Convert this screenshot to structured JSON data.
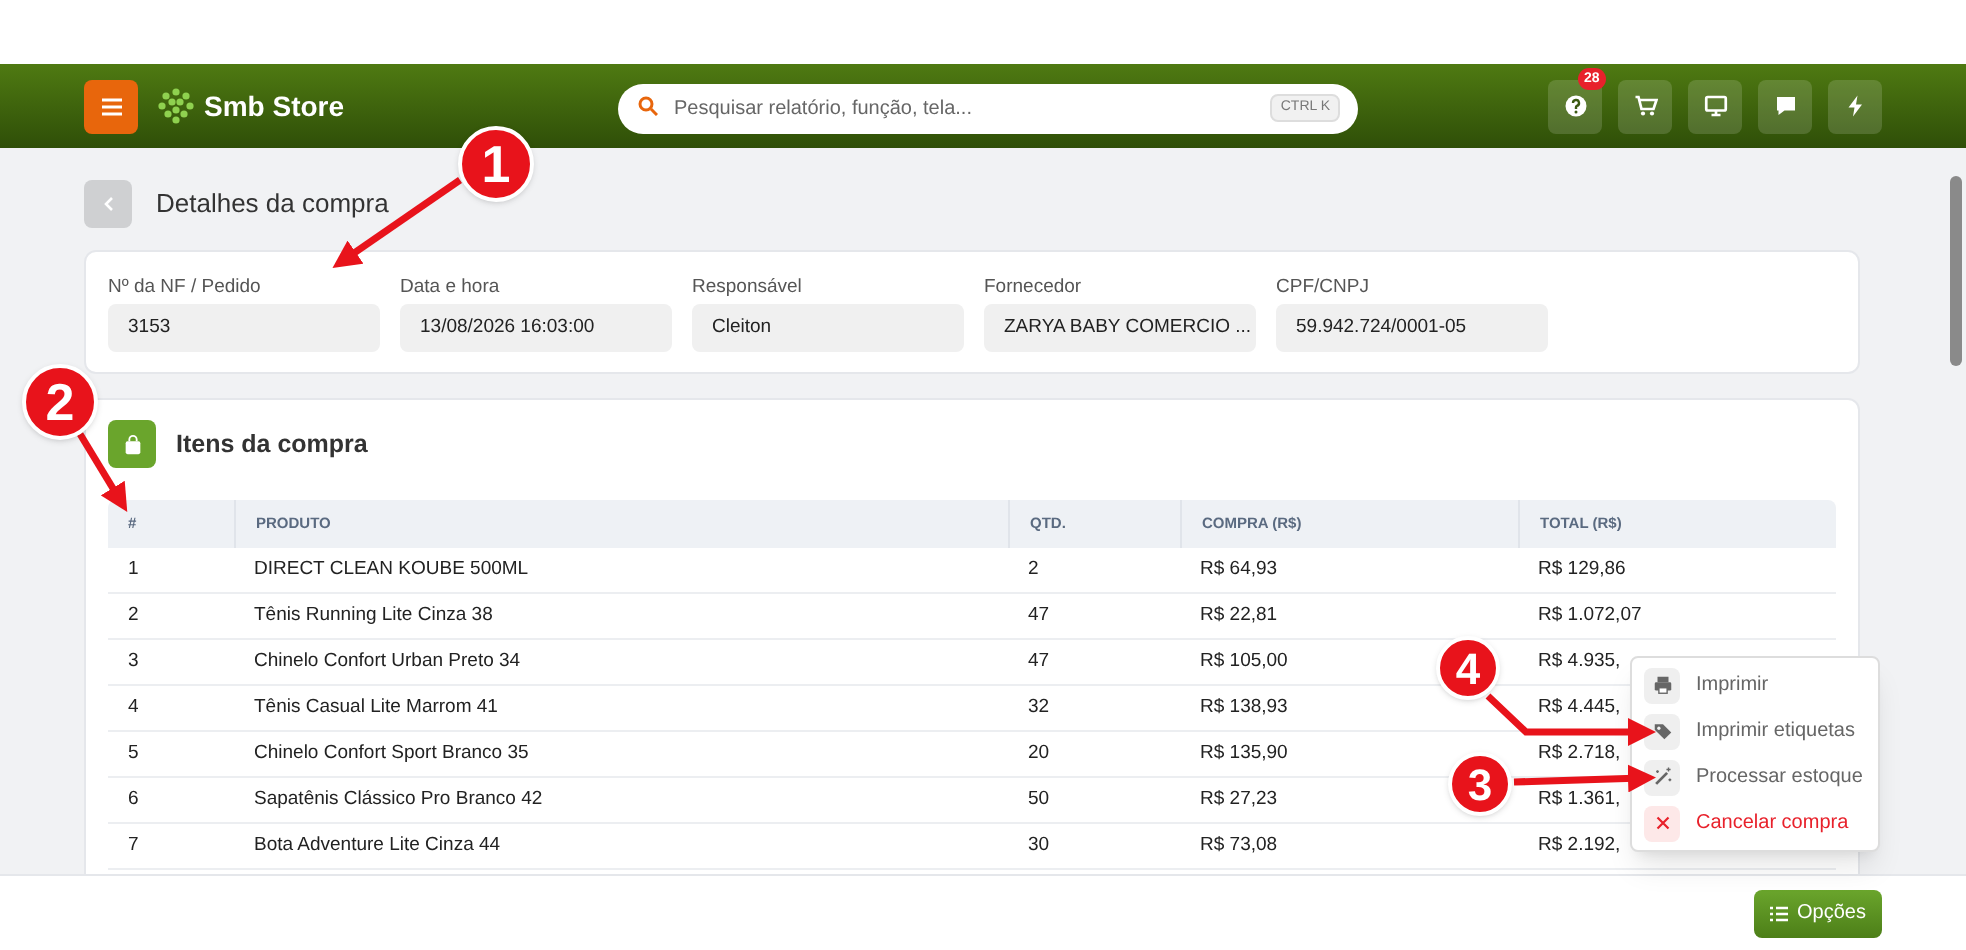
{
  "header": {
    "brand": "Smb Store",
    "search": {
      "placeholder": "Pesquisar relatório, função, tela...",
      "shortcut": "CTRL K"
    },
    "actions": [
      {
        "kind": "help",
        "badge": "28"
      },
      {
        "kind": "cart"
      },
      {
        "kind": "monitor"
      },
      {
        "kind": "chat"
      },
      {
        "kind": "bolt"
      }
    ]
  },
  "page": {
    "title": "Detalhes da compra"
  },
  "fields": [
    {
      "label": "Nº da NF / Pedido",
      "value": "3153"
    },
    {
      "label": "Data e hora",
      "value": "13/08/2026 16:03:00"
    },
    {
      "label": "Responsável",
      "value": "Cleiton"
    },
    {
      "label": "Fornecedor",
      "value": "ZARYA BABY COMERCIO ..."
    },
    {
      "label": "CPF/CNPJ",
      "value": "59.942.724/0001-05"
    }
  ],
  "items": {
    "title": "Itens da compra",
    "columns": [
      "#",
      "PRODUTO",
      "QTD.",
      "COMPRA (R$)",
      "TOTAL (R$)"
    ],
    "rows": [
      [
        "1",
        "DIRECT CLEAN KOUBE 500ML",
        "2",
        "R$ 64,93",
        "R$ 129,86"
      ],
      [
        "2",
        "Tênis Running Lite Cinza 38",
        "47",
        "R$ 22,81",
        "R$ 1.072,07"
      ],
      [
        "3",
        "Chinelo Confort Urban Preto 34",
        "47",
        "R$ 105,00",
        "R$ 4.935,"
      ],
      [
        "4",
        "Tênis Casual Lite Marrom 41",
        "32",
        "R$ 138,93",
        "R$ 4.445,"
      ],
      [
        "5",
        "Chinelo Confort Sport Branco 35",
        "20",
        "R$ 135,90",
        "R$ 2.718,"
      ],
      [
        "6",
        "Sapatênis Clássico Pro Branco 42",
        "50",
        "R$ 27,23",
        "R$ 1.361,"
      ],
      [
        "7",
        "Bota Adventure Lite Cinza 44",
        "30",
        "R$ 73,08",
        "R$ 2.192,"
      ]
    ]
  },
  "menu": [
    {
      "kind": "print",
      "label": "Imprimir"
    },
    {
      "kind": "tags",
      "label": "Imprimir etiquetas"
    },
    {
      "kind": "wand",
      "label": "Processar estoque"
    },
    {
      "kind": "cancel",
      "label": "Cancelar compra"
    }
  ],
  "options_button": "Opções",
  "callouts": [
    "1",
    "2",
    "3",
    "4"
  ]
}
